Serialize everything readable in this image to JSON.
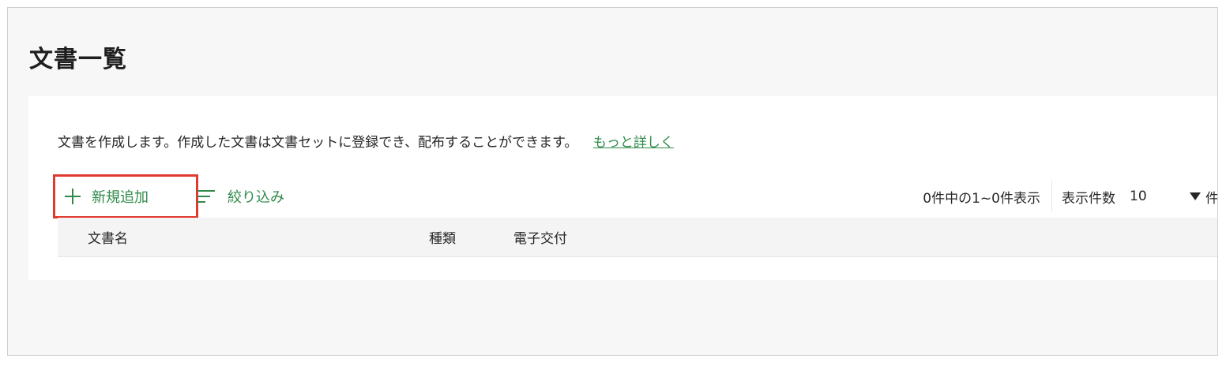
{
  "page": {
    "title": "文書一覧"
  },
  "description": {
    "text": "文書を作成します。作成した文書は文書セットに登録でき、配布することができます。",
    "more_link": "もっと詳しく"
  },
  "toolbar": {
    "add_label": "新規追加",
    "filter_label": "絞り込み"
  },
  "pager": {
    "summary": "0件中の1~0件表示",
    "per_page_label": "表示件数",
    "per_page_value": "10",
    "unit": "件"
  },
  "table": {
    "columns": [
      "文書名",
      "種類",
      "電子交付"
    ]
  },
  "icons": {
    "add": "plus-icon",
    "filter": "filter-icon",
    "select": "caret-down-icon"
  },
  "colors": {
    "accent_green": "#2f8a4a",
    "highlight_red": "#e03a2f"
  }
}
